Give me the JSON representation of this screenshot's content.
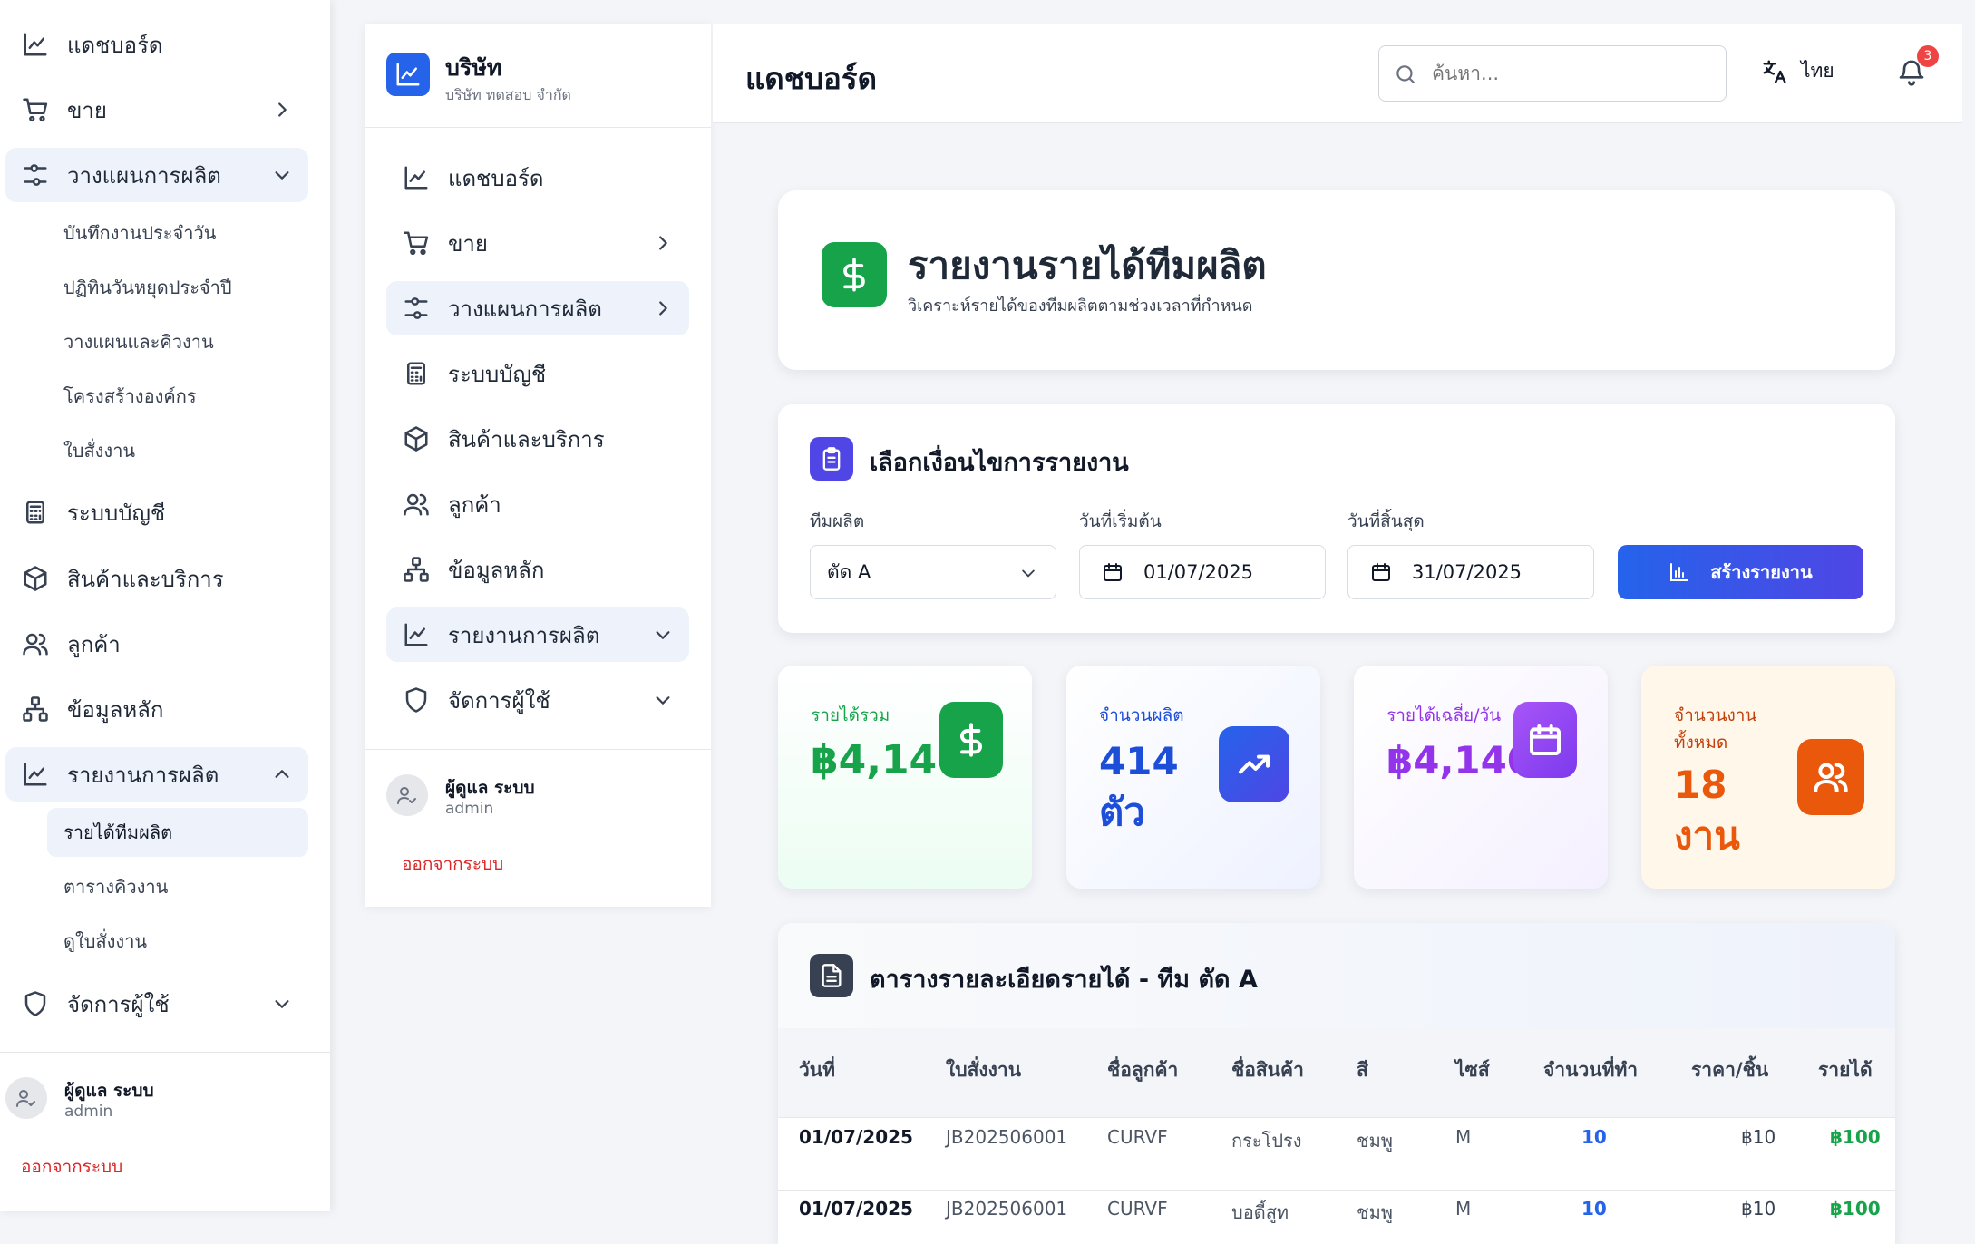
{
  "sidebar_left": {
    "items": [
      {
        "label": "แดชบอร์ด",
        "icon": "chart-line-icon"
      },
      {
        "label": "ขาย",
        "icon": "cart-icon"
      },
      {
        "label": "วางแผนการผลิต",
        "icon": "sliders-icon"
      },
      {
        "label": "ระบบบัญชี",
        "icon": "calculator-icon"
      },
      {
        "label": "สินค้าและบริการ",
        "icon": "box-icon"
      },
      {
        "label": "ลูกค้า",
        "icon": "users-icon"
      },
      {
        "label": "ข้อมูลหลัก",
        "icon": "hierarchy-icon"
      },
      {
        "label": "รายงานการผลิต",
        "icon": "chart-line-icon"
      },
      {
        "label": "จัดการผู้ใช้",
        "icon": "shield-icon"
      }
    ],
    "planning_sub": [
      "บันทึกงานประจำวัน",
      "ปฏิทินวันหยุดประจำปี",
      "วางแผนและคิวงาน",
      "โครงสร้างองค์กร",
      "ใบสั่งงาน"
    ],
    "report_sub": [
      "รายได้ทีมผลิต",
      "ตารางคิวงาน",
      "ดูใบสั่งงาน"
    ],
    "user_name": "ผู้ดูแล ระบบ",
    "user_role": "admin",
    "logout": "ออกจากระบบ"
  },
  "sidebar_right": {
    "company_name": "บริษัท",
    "company_full": "บริษัท ทดสอบ จำกัด",
    "items": [
      "แดชบอร์ด",
      "ขาย",
      "วางแผนการผลิต",
      "ระบบบัญชี",
      "สินค้าและบริการ",
      "ลูกค้า",
      "ข้อมูลหลัก",
      "รายงานการผลิต",
      "จัดการผู้ใช้"
    ],
    "user_name": "ผู้ดูแล ระบบ",
    "user_role": "admin",
    "logout": "ออกจากระบบ"
  },
  "header": {
    "title": "แดชบอร์ด",
    "search_placeholder": "ค้นหา...",
    "language": "ไทย",
    "notification_count": "3"
  },
  "report": {
    "title": "รายงานรายได้ทีมผลิต",
    "subtitle": "วิเคราะห์รายได้ของทีมผลิตตามช่วงเวลาที่กำหนด"
  },
  "filters": {
    "title": "เลือกเงื่อนไขการรายงาน",
    "team_label": "ทีมผลิต",
    "team_value": "ตัด A",
    "start_label": "วันที่เริ่มต้น",
    "start_value": "01/07/2025",
    "end_label": "วันที่สิ้นสุด",
    "end_value": "31/07/2025",
    "button": "สร้างรายงาน"
  },
  "stats": [
    {
      "label": "รายได้รวม",
      "value": "฿4,140",
      "color": "#16a34a"
    },
    {
      "label": "จำนวนผลิต",
      "value": "414 ตัว",
      "color": "#1d4ed8"
    },
    {
      "label": "รายได้เฉลี่ย/วัน",
      "value": "฿4,140",
      "color": "#9333ea"
    },
    {
      "label": "จำนวนงานทั้งหมด",
      "value": "18 งาน",
      "color": "#ea580c"
    }
  ],
  "table": {
    "title": "ตารางรายละเอียดรายได้ - ทีม ตัด A",
    "headers": [
      "วันที่",
      "ใบสั่งงาน",
      "ชื่อลูกค้า",
      "ชื่อสินค้า",
      "สี",
      "ไซส์",
      "จำนวนที่ทำ",
      "ราคา/ชิ้น",
      "รายได้"
    ],
    "rows": [
      [
        "01/07/2025",
        "JB202506001",
        "CURVF",
        "กระโปรง",
        "ชมพู",
        "M",
        "10",
        "฿10",
        "฿100"
      ],
      [
        "01/07/2025",
        "JB202506001",
        "CURVF",
        "บอดี้สูท",
        "ชมพู",
        "M",
        "10",
        "฿10",
        "฿100"
      ]
    ]
  }
}
